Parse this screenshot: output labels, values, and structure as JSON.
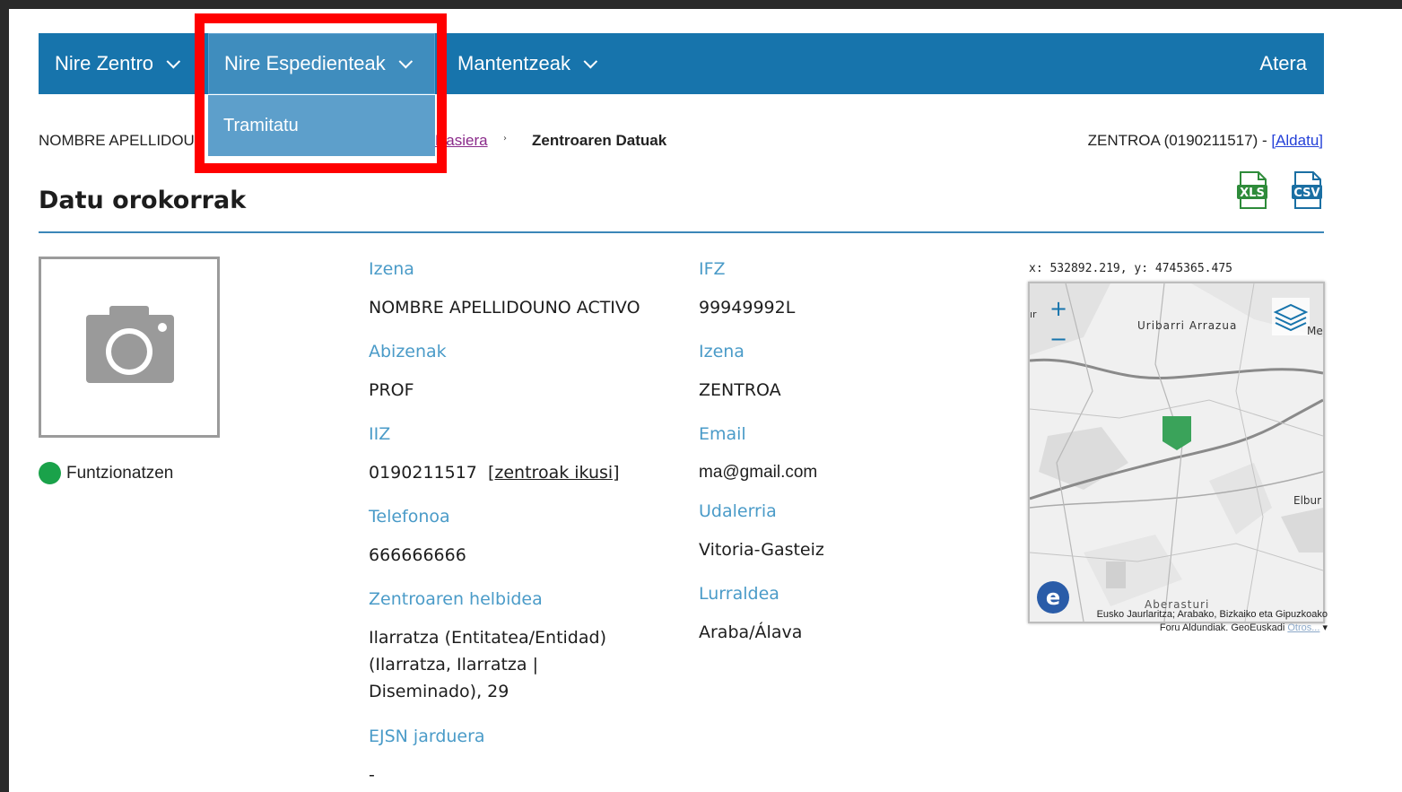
{
  "navbar": {
    "items": [
      {
        "label": "Nire Zentro"
      },
      {
        "label": "Nire Espedienteak"
      },
      {
        "label": "Mantentzeak"
      }
    ],
    "logout_label": "Atera",
    "dropdown_item": "Tramitatu"
  },
  "breadcrumb": {
    "user": "NOMBRE APELLIDOUNO ACTIVO",
    "home_link": "Hasiera",
    "separator": "›",
    "current": "Zentroaren Datuak"
  },
  "center_info": {
    "text": "ZENTROA (0190211517) - ",
    "change_link": "[Aldatu]"
  },
  "section_title": "Datu orokorrak",
  "export": {
    "xls_icon": "xls-file-icon",
    "csv_icon": "csv-file-icon"
  },
  "photo_icon": "camera-icon",
  "status": {
    "label": "Funtzionatzen",
    "color": "#1aa24a"
  },
  "fields_left": {
    "izena_label": "Izena",
    "izena_value": "NOMBRE APELLIDOUNO ACTIVO",
    "abizenak_label": "Abizenak",
    "abizenak_value": "PROF",
    "iiz_label": "IIZ",
    "iiz_value": "0190211517",
    "iiz_link": "[zentroak ikusi]",
    "telefonoa_label": "Telefonoa",
    "telefonoa_value": "666666666",
    "helbidea_label": "Zentroaren helbidea",
    "helbidea_value_1": "Ilarratza (Entitatea/Entidad)",
    "helbidea_value_2": "(Ilarratza, Ilarratza |",
    "helbidea_value_3": "Diseminado), 29",
    "ejsn_label": "EJSN jarduera",
    "ejsn_value": "-"
  },
  "fields_right": {
    "ifz_label": "IFZ",
    "ifz_value": "99949992L",
    "izena_label": "Izena",
    "izena_value": "ZENTROA",
    "email_label": "Email",
    "email_value": "ma@gmail.com",
    "udalerria_label": "Udalerria",
    "udalerria_value": "Vitoria-Gasteiz",
    "lurraldea_label": "Lurraldea",
    "lurraldea_value": "Araba/Álava"
  },
  "map": {
    "coords": "x: 532892.219, y: 4745365.475",
    "zoom_in": "+",
    "zoom_out": "−",
    "place_1": "Uribarri Arrazua",
    "place_2": "Elbur",
    "place_3": "Me",
    "place_4": "Aberasturi",
    "place_5": "ır",
    "attribution_1": "Eusko Jaurlaritza; Arabako, Bizkaiko eta Gipuzkoako",
    "attribution_2": "Foru Aldundiak. GeoEuskadi",
    "attribution_more": "Otros...",
    "marker_color": "#3aa35a"
  }
}
